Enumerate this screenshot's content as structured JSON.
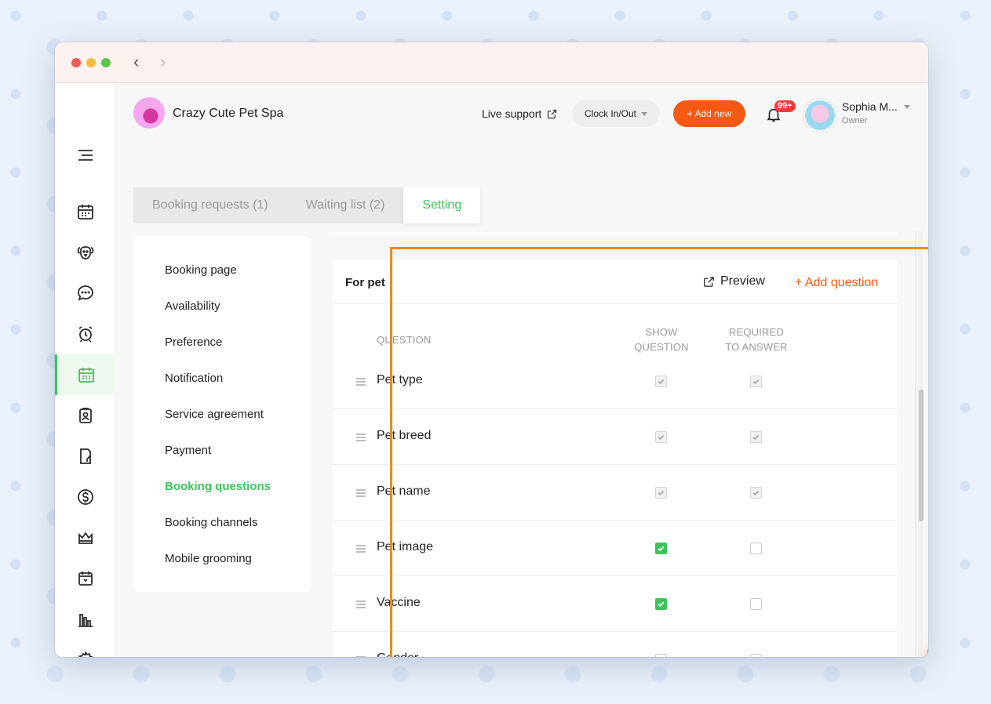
{
  "app": {
    "business_name": "Crazy Cute Pet Spa"
  },
  "header": {
    "live_support": "Live support",
    "clock_label": "Clock In/Out",
    "add_new": "+ Add new",
    "notification_badge": "99+",
    "user_name": "Sophia M...",
    "user_role": "Owner"
  },
  "tabs": [
    {
      "label": "Booking requests (1)",
      "active": false
    },
    {
      "label": "Waiting list (2)",
      "active": false
    },
    {
      "label": "Setting",
      "active": true
    }
  ],
  "sidebar": {
    "icons": [
      "menu-icon",
      "calendar-icon",
      "dog-icon",
      "chat-icon",
      "alarm-icon",
      "booking-calendar-icon",
      "clipboard-icon",
      "report-icon",
      "dollar-icon",
      "crown-icon",
      "schedule-icon",
      "bar-chart-icon",
      "gear-icon"
    ],
    "active": "booking-calendar-icon"
  },
  "settings_menu": {
    "items": [
      {
        "label": "Booking page"
      },
      {
        "label": "Availability"
      },
      {
        "label": "Preference"
      },
      {
        "label": "Notification"
      },
      {
        "label": "Service agreement"
      },
      {
        "label": "Payment"
      },
      {
        "label": "Booking questions",
        "active": true
      },
      {
        "label": "Booking channels"
      },
      {
        "label": "Mobile grooming"
      }
    ]
  },
  "card": {
    "title": "For pet",
    "preview": "Preview",
    "add_question": "+ Add question",
    "columns": {
      "question": "QUESTION",
      "show_line1": "SHOW",
      "show_line2": "QUESTION",
      "required_line1": "REQUIRED",
      "required_line2": "TO ANSWER"
    },
    "rows": [
      {
        "label": "Pet type",
        "show": "checked-disabled",
        "required": "checked-disabled"
      },
      {
        "label": "Pet breed",
        "show": "checked-disabled",
        "required": "checked-disabled"
      },
      {
        "label": "Pet name",
        "show": "checked-disabled",
        "required": "checked-disabled"
      },
      {
        "label": "Pet image",
        "show": "checked",
        "required": "unchecked"
      },
      {
        "label": "Vaccine",
        "show": "checked",
        "required": "unchecked"
      },
      {
        "label": "Gender",
        "show": "unchecked",
        "required": "unchecked"
      }
    ]
  },
  "colors": {
    "accent_green": "#3ec45a",
    "accent_orange": "#f45a14",
    "highlight_orange": "#f28a14",
    "badge_red": "#f23b3b"
  }
}
